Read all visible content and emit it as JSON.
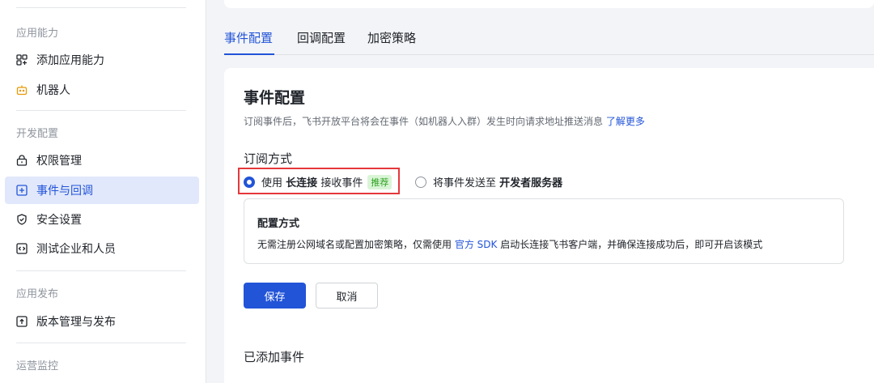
{
  "sidebar": {
    "sections": [
      {
        "label": "应用能力"
      },
      {
        "label": "开发配置"
      },
      {
        "label": "应用发布"
      },
      {
        "label": "运营监控"
      }
    ],
    "items": [
      {
        "label": "添加应用能力",
        "icon": "app-grid-icon"
      },
      {
        "label": "机器人",
        "icon": "robot-icon"
      },
      {
        "label": "权限管理",
        "icon": "lock-icon"
      },
      {
        "label": "事件与回调",
        "icon": "event-icon",
        "active": true
      },
      {
        "label": "安全设置",
        "icon": "shield-icon"
      },
      {
        "label": "测试企业和人员",
        "icon": "code-icon"
      },
      {
        "label": "版本管理与发布",
        "icon": "upload-icon"
      }
    ]
  },
  "tabs": [
    {
      "label": "事件配置",
      "active": true
    },
    {
      "label": "回调配置"
    },
    {
      "label": "加密策略"
    }
  ],
  "card": {
    "title": "事件配置",
    "desc": "订阅事件后，飞书开放平台将会在事件（如机器人入群）发生时向请求地址推送消息",
    "desc_link": "了解更多",
    "sub_title": "订阅方式",
    "option1": {
      "prefix": "使用",
      "bold": "长连接",
      "suffix": "接收事件",
      "tag": "推荐",
      "selected": true
    },
    "option2": {
      "prefix": "将事件发送至",
      "bold": "开发者服务器",
      "selected": false
    },
    "config": {
      "title": "配置方式",
      "desc_before": "无需注册公网域名或配置加密策略，仅需使用",
      "desc_link": "官方 SDK",
      "desc_after": "启动长连接飞书客户端，并确保连接成功后，即可开启该模式"
    },
    "save_label": "保存",
    "cancel_label": "取消",
    "added_title": "已添加事件"
  },
  "colors": {
    "accent": "#2254d8",
    "active_bg": "#e1e8fb",
    "tag_bg": "#d9f5d6",
    "tag_text": "#2ea121",
    "highlight": "#e5383b"
  }
}
